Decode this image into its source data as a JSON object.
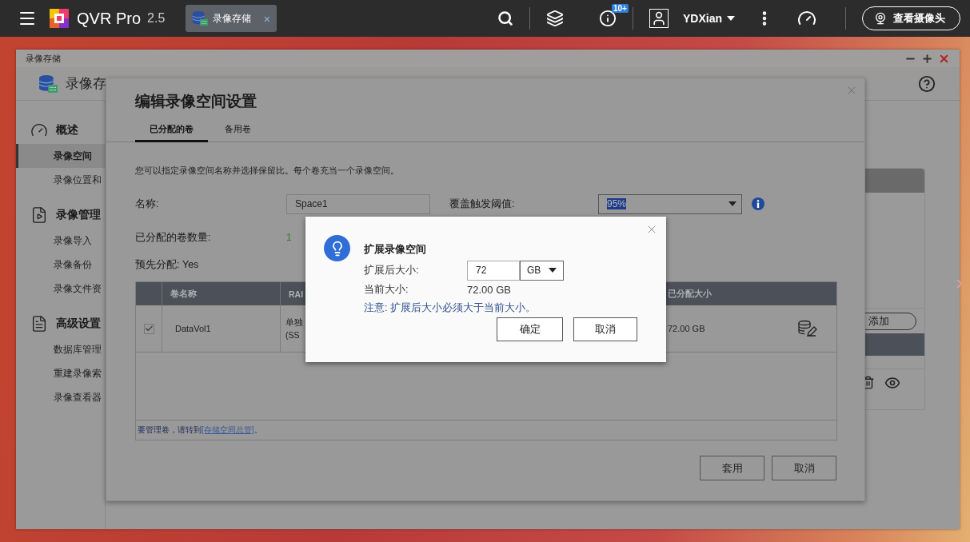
{
  "topbar": {
    "app_name": "QVR Pro",
    "version": "2.5",
    "tabs": [
      {
        "label": "录像存储",
        "selected": true,
        "close": "×"
      }
    ],
    "notification_badge": "10+",
    "user": "YDXian",
    "camera_button": "查看摄像头"
  },
  "window": {
    "title": "录像存储",
    "header": "录像存",
    "sidebar": [
      {
        "label": "概述",
        "kind": "overview",
        "children": [
          {
            "label": "录像空间",
            "selected": true
          },
          {
            "label": "录像位置和",
            "selected": false
          }
        ]
      },
      {
        "label": "录像管理",
        "kind": "manage",
        "children": [
          {
            "label": "录像导入",
            "selected": false
          },
          {
            "label": "录像备份",
            "selected": false
          },
          {
            "label": "录像文件资",
            "selected": false
          }
        ]
      },
      {
        "label": "高级设置",
        "kind": "advanced",
        "children": [
          {
            "label": "数据库管理",
            "selected": false
          },
          {
            "label": "重建录像索",
            "selected": false
          },
          {
            "label": "录像查看器",
            "selected": false
          }
        ]
      }
    ],
    "add_button": "添加"
  },
  "edit_dialog": {
    "title": "编辑录像空间设置",
    "tabs": [
      {
        "label": "已分配的卷",
        "selected": true
      },
      {
        "label": "备用卷",
        "selected": false
      }
    ],
    "description": "您可以指定录像空间名称并选择保留比。每个卷充当一个录像空间。",
    "name_label": "名称:",
    "name_value": "Space1",
    "threshold_label": "覆盖触发阈值:",
    "threshold_value": "95%",
    "count_label": "已分配的卷数量:",
    "count_value": "1",
    "preallocated": "预先分配: Yes",
    "table": {
      "columns": [
        "卷名称",
        "RAI",
        "已分配大小"
      ],
      "rows": [
        {
          "checked": true,
          "name": "DataVol1",
          "raid": [
            "单独",
            "(SS"
          ],
          "allocated": "72.00 GB"
        }
      ]
    },
    "footer_prefix": "要管理卷，请转到",
    "footer_link": "[存储空间总管]",
    "footer_suffix": "。",
    "buttons": [
      "套用",
      "取消"
    ]
  },
  "expand_dialog": {
    "title": "扩展录像空间",
    "size_label": "扩展后大小:",
    "size_value": "72",
    "unit": "GB",
    "current_label": "当前大小:",
    "current_value": "72.00 GB",
    "note": "注意: 扩展后大小必须大于当前大小。",
    "buttons": [
      "确定",
      "取消"
    ]
  }
}
